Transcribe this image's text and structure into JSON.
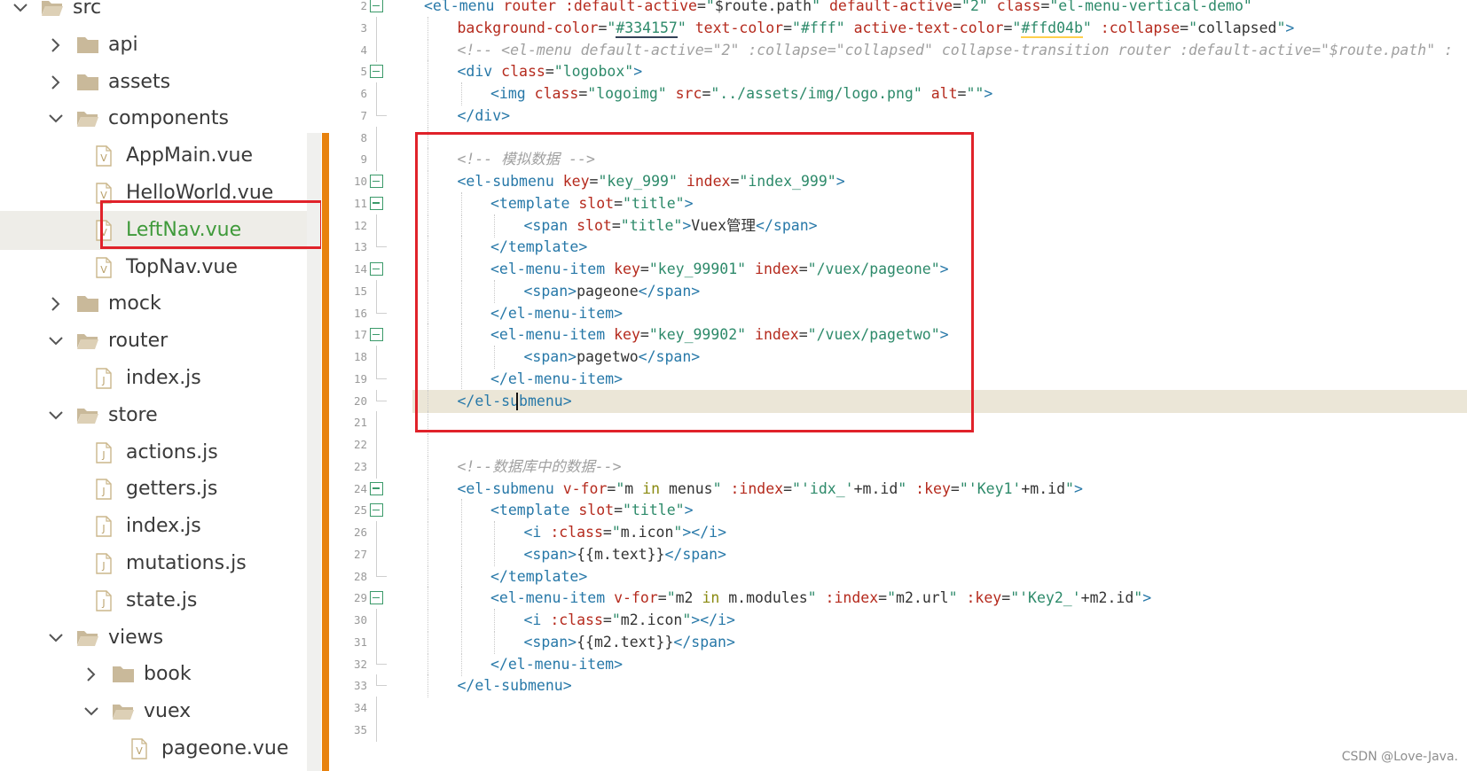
{
  "tree": {
    "items": [
      {
        "name": "src",
        "kind": "folder",
        "depth": 0,
        "expanded": true,
        "selected": false
      },
      {
        "name": "api",
        "kind": "folder",
        "depth": 1,
        "expanded": false,
        "selected": false
      },
      {
        "name": "assets",
        "kind": "folder",
        "depth": 1,
        "expanded": false,
        "selected": false
      },
      {
        "name": "components",
        "kind": "folder",
        "depth": 1,
        "expanded": true,
        "selected": false
      },
      {
        "name": "AppMain.vue",
        "kind": "vue",
        "depth": 2,
        "selected": false
      },
      {
        "name": "HelloWorld.vue",
        "kind": "vue",
        "depth": 2,
        "selected": false
      },
      {
        "name": "LeftNav.vue",
        "kind": "vue",
        "depth": 2,
        "selected": true
      },
      {
        "name": "TopNav.vue",
        "kind": "vue",
        "depth": 2,
        "selected": false
      },
      {
        "name": "mock",
        "kind": "folder",
        "depth": 1,
        "expanded": false,
        "selected": false
      },
      {
        "name": "router",
        "kind": "folder",
        "depth": 1,
        "expanded": true,
        "selected": false
      },
      {
        "name": "index.js",
        "kind": "js",
        "depth": 2,
        "selected": false
      },
      {
        "name": "store",
        "kind": "folder",
        "depth": 1,
        "expanded": true,
        "selected": false
      },
      {
        "name": "actions.js",
        "kind": "js",
        "depth": 2,
        "selected": false
      },
      {
        "name": "getters.js",
        "kind": "js",
        "depth": 2,
        "selected": false
      },
      {
        "name": "index.js",
        "kind": "js",
        "depth": 2,
        "selected": false
      },
      {
        "name": "mutations.js",
        "kind": "js",
        "depth": 2,
        "selected": false
      },
      {
        "name": "state.js",
        "kind": "js",
        "depth": 2,
        "selected": false
      },
      {
        "name": "views",
        "kind": "folder",
        "depth": 1,
        "expanded": true,
        "selected": false
      },
      {
        "name": "book",
        "kind": "folder",
        "depth": 2,
        "expanded": false,
        "selected": false
      },
      {
        "name": "vuex",
        "kind": "folder",
        "depth": 2,
        "expanded": true,
        "selected": false
      },
      {
        "name": "pageone.vue",
        "kind": "vue",
        "depth": 3,
        "selected": false
      }
    ]
  },
  "editor": {
    "current_line": 20,
    "lines": [
      {
        "n": "2",
        "fold": "open",
        "indent": 1,
        "tokens": [
          [
            "tag",
            "<el-menu "
          ],
          [
            "attr",
            "router "
          ],
          [
            "attr",
            ":default-active"
          ],
          [
            "op",
            "="
          ],
          [
            "str",
            "\""
          ],
          [
            "text",
            "$route.path"
          ],
          [
            "str",
            "\" "
          ],
          [
            "attr",
            "default-active"
          ],
          [
            "op",
            "="
          ],
          [
            "str",
            "\"2\" "
          ],
          [
            "attr",
            "class"
          ],
          [
            "op",
            "="
          ],
          [
            "str",
            "\"el-menu-vertical-demo\""
          ]
        ]
      },
      {
        "n": "3",
        "fold": "line",
        "indent": 2,
        "tokens": [
          [
            "attr",
            "background-color"
          ],
          [
            "op",
            "="
          ],
          [
            "str",
            "\""
          ],
          [
            "u1",
            "#334157"
          ],
          [
            "str",
            "\" "
          ],
          [
            "attr",
            "text-color"
          ],
          [
            "op",
            "="
          ],
          [
            "str",
            "\"#fff\" "
          ],
          [
            "attr",
            "active-text-color"
          ],
          [
            "op",
            "="
          ],
          [
            "str",
            "\""
          ],
          [
            "u2",
            "#ffd04b"
          ],
          [
            "str",
            "\" "
          ],
          [
            "attr",
            ":collapse"
          ],
          [
            "op",
            "="
          ],
          [
            "str",
            "\""
          ],
          [
            "text",
            "collapsed"
          ],
          [
            "str",
            "\""
          ],
          [
            "tag",
            ">"
          ]
        ]
      },
      {
        "n": "4",
        "fold": "line",
        "indent": 2,
        "tokens": [
          [
            "cmt",
            "<!-- <el-menu default-active=\"2\" :collapse=\"collapsed\" collapse-transition router :default-active=\"$route.path\" :"
          ]
        ]
      },
      {
        "n": "5",
        "fold": "open",
        "indent": 2,
        "tokens": [
          [
            "tag",
            "<div "
          ],
          [
            "attr",
            "class"
          ],
          [
            "op",
            "="
          ],
          [
            "str",
            "\"logobox\""
          ],
          [
            "tag",
            ">"
          ]
        ]
      },
      {
        "n": "6",
        "fold": "line",
        "indent": 3,
        "tokens": [
          [
            "tag",
            "<img "
          ],
          [
            "attr",
            "class"
          ],
          [
            "op",
            "="
          ],
          [
            "str",
            "\"logoimg\" "
          ],
          [
            "attr",
            "src"
          ],
          [
            "op",
            "="
          ],
          [
            "str",
            "\"../assets/img/logo.png\" "
          ],
          [
            "attr",
            "alt"
          ],
          [
            "op",
            "="
          ],
          [
            "str",
            "\"\""
          ],
          [
            "tag",
            ">"
          ]
        ]
      },
      {
        "n": "7",
        "fold": "end",
        "indent": 2,
        "tokens": [
          [
            "tag",
            "</div>"
          ]
        ]
      },
      {
        "n": "8",
        "fold": "line",
        "indent": 2,
        "tokens": []
      },
      {
        "n": "9",
        "fold": "line",
        "indent": 2,
        "tokens": [
          [
            "cmt",
            "<!-- 模拟数据 -->"
          ]
        ]
      },
      {
        "n": "10",
        "fold": "open",
        "indent": 2,
        "tokens": [
          [
            "tag",
            "<el-submenu "
          ],
          [
            "attr",
            "key"
          ],
          [
            "op",
            "="
          ],
          [
            "str",
            "\"key_999\" "
          ],
          [
            "attr",
            "index"
          ],
          [
            "op",
            "="
          ],
          [
            "str",
            "\"index_999\""
          ],
          [
            "tag",
            ">"
          ]
        ]
      },
      {
        "n": "11",
        "fold": "open",
        "indent": 3,
        "tokens": [
          [
            "tag",
            "<template "
          ],
          [
            "attr",
            "slot"
          ],
          [
            "op",
            "="
          ],
          [
            "str",
            "\"title\""
          ],
          [
            "tag",
            ">"
          ]
        ]
      },
      {
        "n": "12",
        "fold": "line",
        "indent": 4,
        "tokens": [
          [
            "tag",
            "<span "
          ],
          [
            "attr",
            "slot"
          ],
          [
            "op",
            "="
          ],
          [
            "str",
            "\"title\""
          ],
          [
            "tag",
            ">"
          ],
          [
            "text",
            "Vuex管理"
          ],
          [
            "tag",
            "</span>"
          ]
        ]
      },
      {
        "n": "13",
        "fold": "end",
        "indent": 3,
        "tokens": [
          [
            "tag",
            "</template>"
          ]
        ]
      },
      {
        "n": "14",
        "fold": "open",
        "indent": 3,
        "tokens": [
          [
            "tag",
            "<el-menu-item "
          ],
          [
            "attr",
            "key"
          ],
          [
            "op",
            "="
          ],
          [
            "str",
            "\"key_99901\" "
          ],
          [
            "attr",
            "index"
          ],
          [
            "op",
            "="
          ],
          [
            "str",
            "\"/vuex/pageone\""
          ],
          [
            "tag",
            ">"
          ]
        ]
      },
      {
        "n": "15",
        "fold": "line",
        "indent": 4,
        "tokens": [
          [
            "tag",
            "<span>"
          ],
          [
            "text",
            "pageone"
          ],
          [
            "tag",
            "</span>"
          ]
        ]
      },
      {
        "n": "16",
        "fold": "end",
        "indent": 3,
        "tokens": [
          [
            "tag",
            "</el-menu-item>"
          ]
        ]
      },
      {
        "n": "17",
        "fold": "open",
        "indent": 3,
        "tokens": [
          [
            "tag",
            "<el-menu-item "
          ],
          [
            "attr",
            "key"
          ],
          [
            "op",
            "="
          ],
          [
            "str",
            "\"key_99902\" "
          ],
          [
            "attr",
            "index"
          ],
          [
            "op",
            "="
          ],
          [
            "str",
            "\"/vuex/pagetwo\""
          ],
          [
            "tag",
            ">"
          ]
        ]
      },
      {
        "n": "18",
        "fold": "line",
        "indent": 4,
        "tokens": [
          [
            "tag",
            "<span>"
          ],
          [
            "text",
            "pagetwo"
          ],
          [
            "tag",
            "</span>"
          ]
        ]
      },
      {
        "n": "19",
        "fold": "end",
        "indent": 3,
        "tokens": [
          [
            "tag",
            "</el-menu-item>"
          ]
        ]
      },
      {
        "n": "20",
        "fold": "end",
        "indent": 2,
        "tokens": [
          [
            "tag",
            "</el-submenu>"
          ]
        ]
      },
      {
        "n": "21",
        "fold": "line",
        "indent": 2,
        "tokens": []
      },
      {
        "n": "22",
        "fold": "line",
        "indent": 2,
        "tokens": []
      },
      {
        "n": "23",
        "fold": "line",
        "indent": 2,
        "tokens": [
          [
            "cmt",
            "<!--数据库中的数据-->"
          ]
        ]
      },
      {
        "n": "24",
        "fold": "open",
        "indent": 2,
        "tokens": [
          [
            "tag",
            "<el-submenu "
          ],
          [
            "attr",
            "v-for"
          ],
          [
            "op",
            "="
          ],
          [
            "str",
            "\""
          ],
          [
            "text",
            "m "
          ],
          [
            "kw",
            "in"
          ],
          [
            "text",
            " menus"
          ],
          [
            "str",
            "\" "
          ],
          [
            "attr",
            ":index"
          ],
          [
            "op",
            "="
          ],
          [
            "str",
            "\""
          ],
          [
            "str",
            "'idx_'"
          ],
          [
            "text",
            "+m.id"
          ],
          [
            "str",
            "\" "
          ],
          [
            "attr",
            ":key"
          ],
          [
            "op",
            "="
          ],
          [
            "str",
            "\""
          ],
          [
            "str",
            "'Key1'"
          ],
          [
            "text",
            "+m.id"
          ],
          [
            "str",
            "\""
          ],
          [
            "tag",
            ">"
          ]
        ]
      },
      {
        "n": "25",
        "fold": "open",
        "indent": 3,
        "tokens": [
          [
            "tag",
            "<template "
          ],
          [
            "attr",
            "slot"
          ],
          [
            "op",
            "="
          ],
          [
            "str",
            "\"title\""
          ],
          [
            "tag",
            ">"
          ]
        ]
      },
      {
        "n": "26",
        "fold": "line",
        "indent": 4,
        "tokens": [
          [
            "tag",
            "<i "
          ],
          [
            "attr",
            ":class"
          ],
          [
            "op",
            "="
          ],
          [
            "str",
            "\""
          ],
          [
            "text",
            "m.icon"
          ],
          [
            "str",
            "\""
          ],
          [
            "tag",
            "></i>"
          ]
        ]
      },
      {
        "n": "27",
        "fold": "line",
        "indent": 4,
        "tokens": [
          [
            "tag",
            "<span>"
          ],
          [
            "text",
            "{{m.text}}"
          ],
          [
            "tag",
            "</span>"
          ]
        ]
      },
      {
        "n": "28",
        "fold": "end",
        "indent": 3,
        "tokens": [
          [
            "tag",
            "</template>"
          ]
        ]
      },
      {
        "n": "29",
        "fold": "open",
        "indent": 3,
        "tokens": [
          [
            "tag",
            "<el-menu-item "
          ],
          [
            "attr",
            "v-for"
          ],
          [
            "op",
            "="
          ],
          [
            "str",
            "\""
          ],
          [
            "text",
            "m2 "
          ],
          [
            "kw",
            "in"
          ],
          [
            "text",
            " m.modules"
          ],
          [
            "str",
            "\" "
          ],
          [
            "attr",
            ":index"
          ],
          [
            "op",
            "="
          ],
          [
            "str",
            "\""
          ],
          [
            "text",
            "m2.url"
          ],
          [
            "str",
            "\" "
          ],
          [
            "attr",
            ":key"
          ],
          [
            "op",
            "="
          ],
          [
            "str",
            "\""
          ],
          [
            "str",
            "'Key2_'"
          ],
          [
            "text",
            "+m2.id"
          ],
          [
            "str",
            "\""
          ],
          [
            "tag",
            ">"
          ]
        ]
      },
      {
        "n": "30",
        "fold": "line",
        "indent": 4,
        "tokens": [
          [
            "tag",
            "<i "
          ],
          [
            "attr",
            ":class"
          ],
          [
            "op",
            "="
          ],
          [
            "str",
            "\""
          ],
          [
            "text",
            "m2.icon"
          ],
          [
            "str",
            "\""
          ],
          [
            "tag",
            "></i>"
          ]
        ]
      },
      {
        "n": "31",
        "fold": "line",
        "indent": 4,
        "tokens": [
          [
            "tag",
            "<span>"
          ],
          [
            "text",
            "{{m2.text}}"
          ],
          [
            "tag",
            "</span>"
          ]
        ]
      },
      {
        "n": "32",
        "fold": "end",
        "indent": 3,
        "tokens": [
          [
            "tag",
            "</el-menu-item>"
          ]
        ]
      },
      {
        "n": "33",
        "fold": "end",
        "indent": 2,
        "tokens": [
          [
            "tag",
            "</el-submenu>"
          ]
        ]
      },
      {
        "n": "34",
        "fold": "line",
        "indent": 1,
        "tokens": []
      },
      {
        "n": "35",
        "fold": "line",
        "indent": 1,
        "tokens": []
      }
    ]
  },
  "colors": {
    "highlight_border": "#e0222a",
    "divider": "#e8820e",
    "tag": "#2778a8",
    "attribute": "#b52a1d",
    "string": "#2d8a6a",
    "comment": "#a0a0a0",
    "selected_file": "#3f9a3a"
  },
  "watermark": "CSDN @Love-Java."
}
